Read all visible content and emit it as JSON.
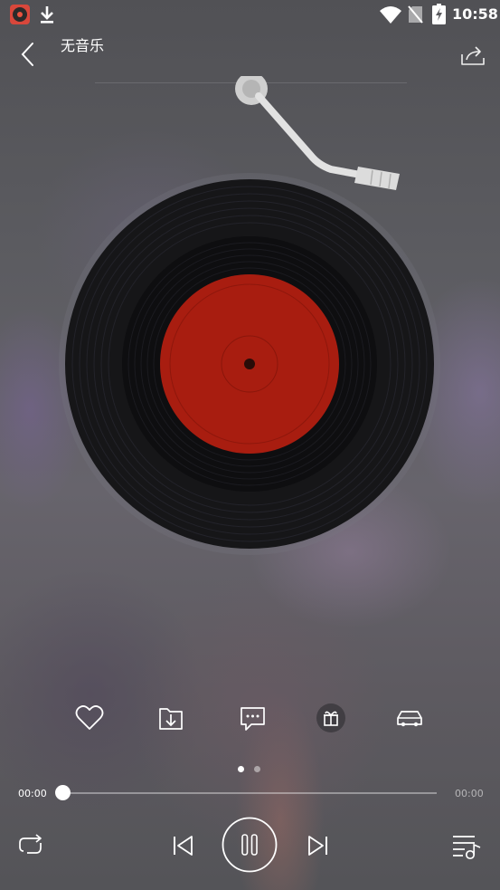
{
  "status_bar": {
    "time": "10:58",
    "left_icons": [
      "music-app-icon",
      "download-icon"
    ],
    "right_icons": [
      "wifi-icon",
      "no-sim-icon",
      "battery-charging-icon"
    ]
  },
  "header": {
    "title": "无音乐",
    "back_icon": "chevron-left-icon",
    "share_icon": "share-icon"
  },
  "player": {
    "record_label_color": "#a81d10",
    "record_color": "#141416",
    "actions": [
      {
        "name": "like",
        "icon": "heart-icon"
      },
      {
        "name": "download",
        "icon": "download-folder-icon"
      },
      {
        "name": "comment",
        "icon": "comment-icon"
      },
      {
        "name": "gift",
        "icon": "gift-icon"
      },
      {
        "name": "car-mode",
        "icon": "car-icon"
      }
    ],
    "page_indicator": {
      "count": 2,
      "active": 1
    },
    "progress": {
      "current": "00:00",
      "total": "00:00",
      "fraction": 0
    },
    "controls": {
      "repeat_icon": "repeat-icon",
      "prev_icon": "skip-previous-icon",
      "play_state": "playing",
      "pause_icon": "pause-icon",
      "next_icon": "skip-next-icon",
      "playlist_icon": "playlist-icon"
    }
  }
}
